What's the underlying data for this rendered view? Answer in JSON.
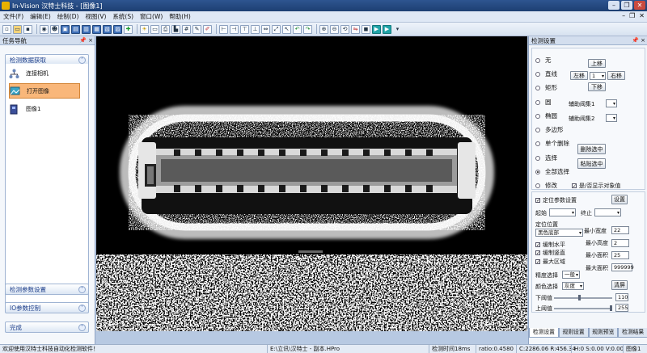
{
  "window": {
    "title": "In-Vision    汉特士科技 - [图像1]",
    "minimize": "–",
    "restore": "❐",
    "close": "✕"
  },
  "menu": {
    "items": [
      "文件(F)",
      "编辑(E)",
      "绘制(D)",
      "视图(V)",
      "系统(S)",
      "窗口(W)",
      "帮助(H)"
    ],
    "right": [
      "–",
      "❐",
      "✕"
    ]
  },
  "toolbar": {
    "icons": [
      "new-file-icon",
      "open-folder-icon",
      "save-icon",
      "camera-icon",
      "user-icon",
      "layout-1-icon",
      "layout-2-icon",
      "layout-3-icon",
      "layout-4-icon",
      "layout-5-icon",
      "layout-6-icon",
      "crosshair-icon",
      "bulb-icon",
      "display-icon",
      "printer-icon",
      "chart-icon",
      "grid-icon",
      "edit-icon",
      "paint-icon",
      "align-left-icon",
      "align-right-icon",
      "align-top-icon",
      "align-bottom-icon",
      "resize-icon",
      "fit-icon",
      "arrow-icon",
      "undo-icon",
      "redo-icon",
      "zoom-in-icon",
      "zoom-out-icon",
      "reset-icon",
      "flip-icon",
      "stop-icon",
      "play-icon",
      "record-icon",
      "dropdown-icon"
    ]
  },
  "left_panel": {
    "title": "任务导航",
    "pin": "📌 ×",
    "section1": {
      "label": "检测数据获取",
      "chev": "˄"
    },
    "items": [
      {
        "label": "连接相机"
      },
      {
        "label": "打开图像"
      },
      {
        "label": "图像1"
      }
    ],
    "sections": [
      {
        "label": "检测参数设置",
        "chev": "˅"
      },
      {
        "label": "IO参数控制",
        "chev": "˅"
      },
      {
        "label": "完成",
        "chev": "˅"
      }
    ]
  },
  "right_panel": {
    "title": "检测设置",
    "pin": "📌 ×",
    "shapes": [
      "无",
      "直线",
      "矩形",
      "圆",
      "椭圆",
      "多边形",
      "单个删除",
      "选择",
      "全部选择",
      "修改"
    ],
    "selected_shape": "全部选择",
    "move": {
      "up": "上移",
      "left": "左移",
      "right": "右移",
      "down": "下移",
      "step": "1"
    },
    "aux": [
      {
        "label": "辅助阈集1",
        "value": ""
      },
      {
        "label": "辅助阈集2",
        "value": ""
      }
    ],
    "buttons": {
      "delete": "删除选中",
      "paste": "粘贴选中",
      "setup": "设置",
      "clear": "清屏"
    },
    "show_obj": {
      "label": "是/否显示对象值",
      "checked": true
    },
    "locate": {
      "label": "定位参数设置",
      "checked": true
    },
    "start_label": "起始",
    "start_value": "",
    "end_label": "终止",
    "end_value": "",
    "position": {
      "label": "定位位置",
      "value": "黑色底部"
    },
    "strong_h": {
      "label": "缓制水平",
      "checked": true
    },
    "strong_v": {
      "label": "缓制竖直",
      "checked": true
    },
    "max_region": {
      "label": "最大区域",
      "checked": true
    },
    "min_width": {
      "label": "最小宽度",
      "value": "22"
    },
    "min_height": {
      "label": "最小高度",
      "value": "2"
    },
    "min_area": {
      "label": "最小面积",
      "value": "25"
    },
    "max_area": {
      "label": "最大面积",
      "value": "999999"
    },
    "precision": {
      "label": "精度选择",
      "value": "一般"
    },
    "color": {
      "label": "颜色选择",
      "value": "灰度"
    },
    "lower": {
      "label": "下阈值",
      "value": "110",
      "level": 0.43
    },
    "upper": {
      "label": "上阈值",
      "value": "255",
      "level": 1.0
    },
    "tabs": [
      "检测设置",
      "规则设置",
      "规则预览",
      "检测结果"
    ],
    "active_tab": 0
  },
  "status": {
    "welcome": "欢迎使用汉特士科技自动化检测软件！",
    "path": "E:\\立讯\\汉特士 - 副本.HPro",
    "time": "检测时间18ms",
    "ratio": "ratio:0.4580",
    "coord": "C:2286.06 R:456.34",
    "hsv": "H:0 S:0.00 V:0.00",
    "image": "图像1"
  },
  "colors": {
    "accent": "#1d3f72",
    "selected_item": "#f9b77a",
    "panel": "#d3deee"
  }
}
